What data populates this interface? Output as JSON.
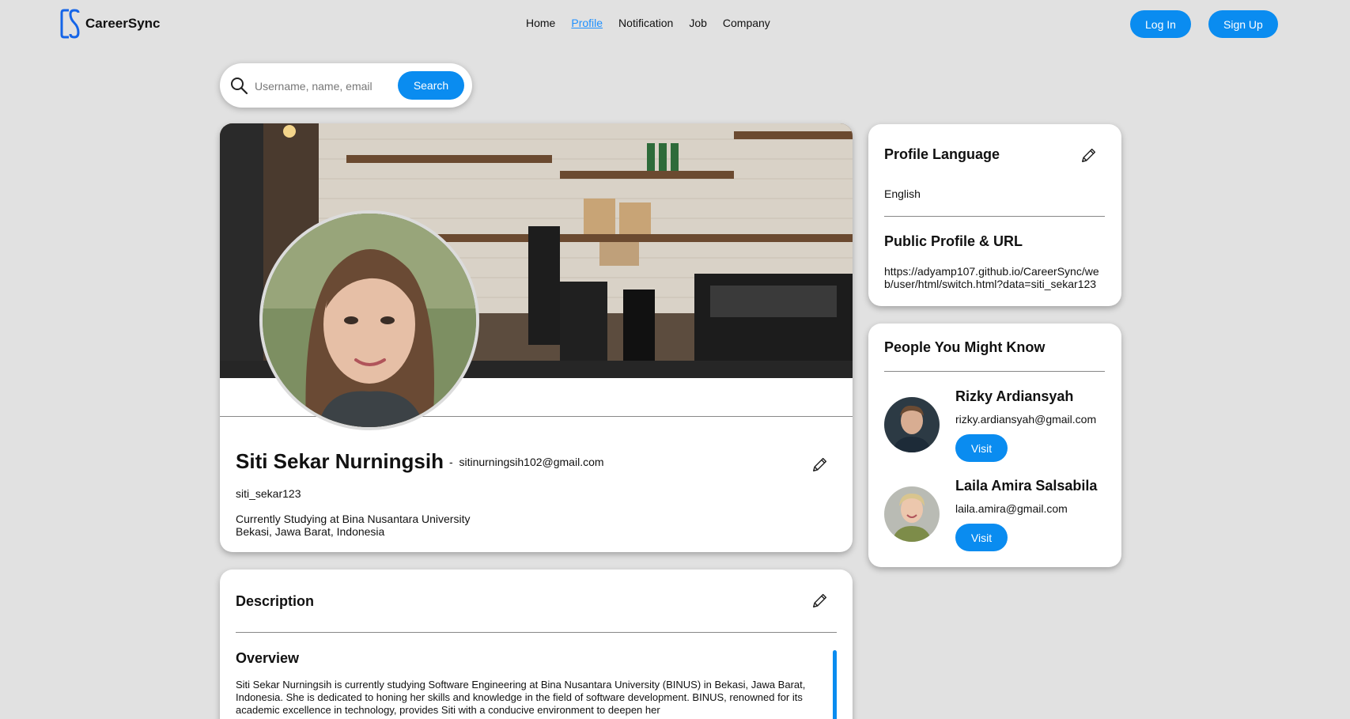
{
  "app": {
    "name": "CareerSync"
  },
  "nav": {
    "links": [
      {
        "label": "Home",
        "active": false
      },
      {
        "label": "Profile",
        "active": true
      },
      {
        "label": "Notification",
        "active": false
      },
      {
        "label": "Job",
        "active": false
      },
      {
        "label": "Company",
        "active": false
      }
    ],
    "login_label": "Log In",
    "signup_label": "Sign Up"
  },
  "search": {
    "placeholder": "Username, name, email",
    "value": "",
    "button_label": "Search"
  },
  "profile": {
    "name": "Siti Sekar Nurningsih",
    "separator": "-",
    "email": "sitinurningsih102@gmail.com",
    "username": "siti_sekar123",
    "status": "Currently Studying at Bina Nusantara University",
    "location": "Bekasi, Jawa Barat, Indonesia"
  },
  "description": {
    "title": "Description",
    "overview_title": "Overview",
    "overview_text": "Siti Sekar Nurningsih is currently studying Software Engineering at Bina Nusantara University (BINUS) in Bekasi, Jawa Barat, Indonesia. She is dedicated to honing her skills and knowledge in the field of software development. BINUS, renowned for its academic excellence in technology, provides Siti with a conducive environment to deepen her"
  },
  "language_card": {
    "title": "Profile Language",
    "value": "English",
    "url_title": "Public Profile & URL",
    "url": "https://adyamp107.github.io/CareerSync/web/user/html/switch.html?data=siti_sekar123"
  },
  "people": {
    "title": "People You Might Know",
    "visit_label": "Visit",
    "items": [
      {
        "name": "Rizky Ardiansyah",
        "email": "rizky.ardiansyah@gmail.com"
      },
      {
        "name": "Laila Amira Salsabila",
        "email": "laila.amira@gmail.com"
      }
    ]
  },
  "colors": {
    "accent": "#0a8cf0",
    "background": "#e1e1e1",
    "active_link": "#1e90ff"
  }
}
